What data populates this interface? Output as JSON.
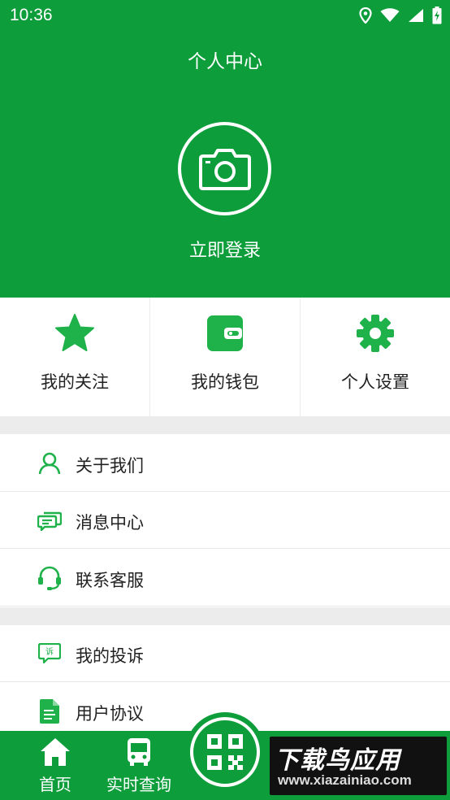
{
  "status_bar": {
    "time": "10:36"
  },
  "header": {
    "title": "个人中心",
    "login_label": "立即登录"
  },
  "quick_actions": [
    {
      "label": "我的关注",
      "icon": "star-icon"
    },
    {
      "label": "我的钱包",
      "icon": "wallet-icon"
    },
    {
      "label": "个人设置",
      "icon": "gear-icon"
    }
  ],
  "menu_group_1": [
    {
      "label": "关于我们",
      "icon": "user-icon"
    },
    {
      "label": "消息中心",
      "icon": "message-icon"
    },
    {
      "label": "联系客服",
      "icon": "headset-icon"
    }
  ],
  "menu_group_2": [
    {
      "label": "我的投诉",
      "icon": "complaint-icon"
    },
    {
      "label": "用户协议",
      "icon": "document-icon"
    }
  ],
  "bottom_nav": {
    "home": "首页",
    "realtime": "实时查询",
    "scan_icon": "qrcode-icon"
  },
  "watermark": {
    "main": "下载鸟应用",
    "sub": "www.xiazainiao.com"
  },
  "colors": {
    "brand": "#0d9e3b",
    "divider": "#ececec"
  }
}
